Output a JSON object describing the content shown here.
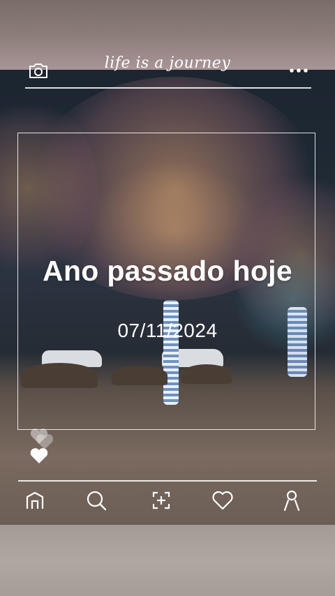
{
  "header": {
    "brand": "life is a journey",
    "camera_icon": "camera-icon",
    "menu_icon": "more-dots-icon"
  },
  "post": {
    "heading": "Ano passado hoje",
    "date": "07/11/2024"
  },
  "reactions": {
    "like_icon": "heart-icon"
  },
  "nav": {
    "items": [
      {
        "icon": "home-icon"
      },
      {
        "icon": "search-icon"
      },
      {
        "icon": "add-post-icon"
      },
      {
        "icon": "heart-outline-icon"
      },
      {
        "icon": "profile-icon"
      }
    ]
  },
  "colors": {
    "overlay_text": "#ffffff",
    "band_top": "#8a7b77",
    "band_bottom": "#b1a7a1"
  }
}
